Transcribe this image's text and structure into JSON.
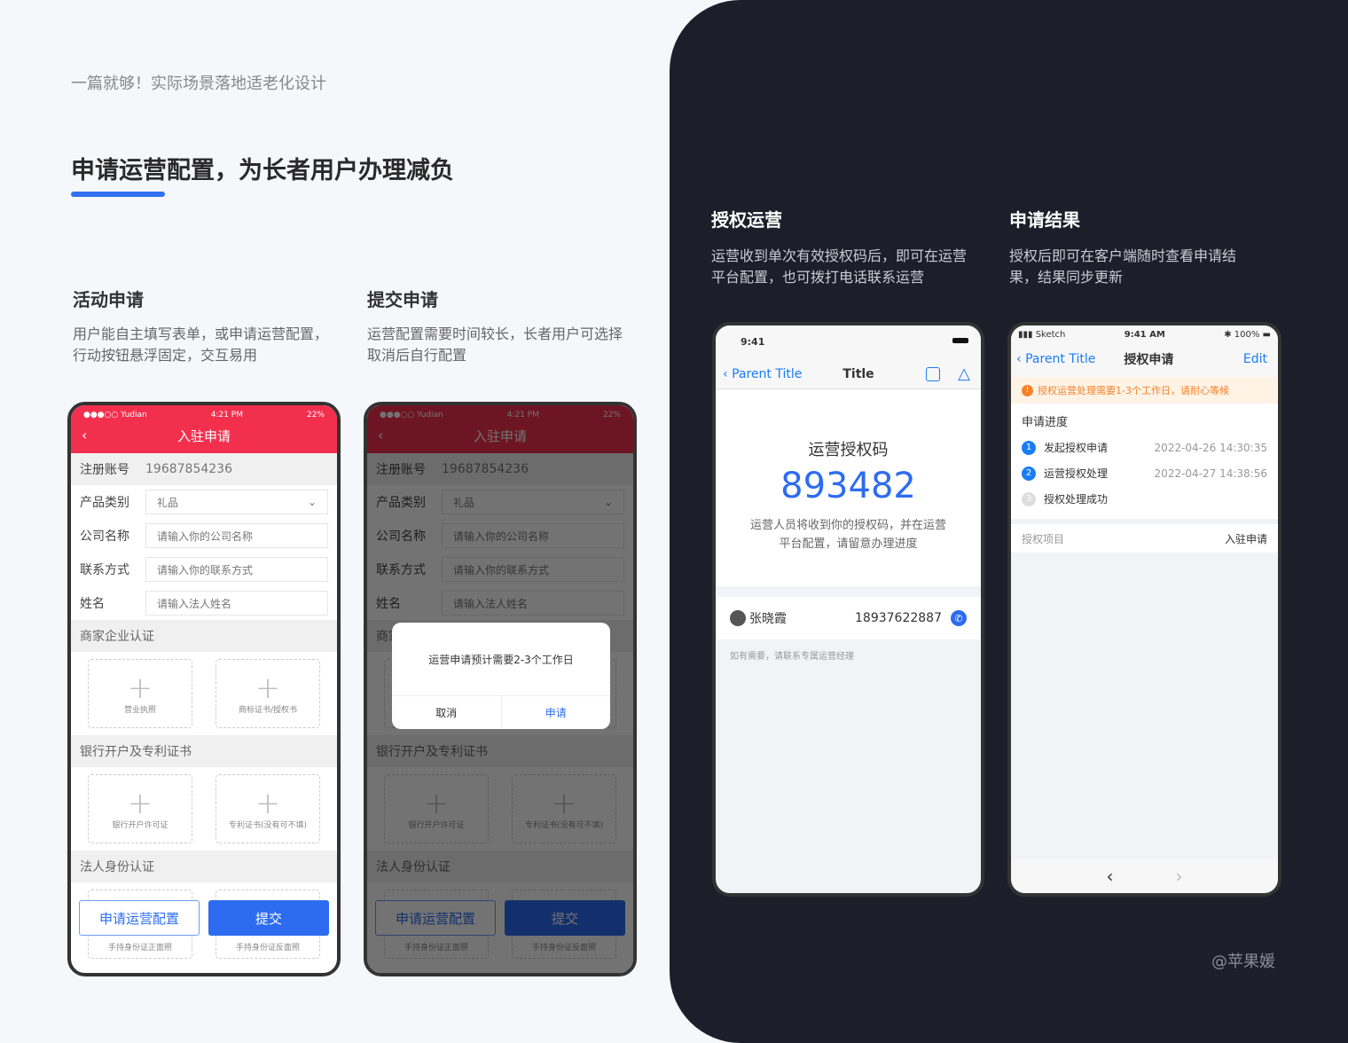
{
  "header": {
    "subtitle": "一篇就够！实际场景落地适老化设计",
    "title": "申请运营配置，为长者用户办理减负"
  },
  "sections": [
    {
      "title": "活动申请",
      "desc": "用户能自主填写表单，或申请运营配置，行动按钮悬浮固定，交互易用"
    },
    {
      "title": "提交申请",
      "desc": "运营配置需要时间较长，长者用户可选择取消后自行配置"
    },
    {
      "title": "授权运营",
      "desc": "运营收到单次有效授权码后，即可在运营平台配置，也可拨打电话联系运营"
    },
    {
      "title": "申请结果",
      "desc": "授权后即可在客户端随时查看申请结果，结果同步更新"
    }
  ],
  "form": {
    "status": {
      "carrier": "●●●○○ Yudian",
      "time": "4:21 PM",
      "battery": "22%"
    },
    "nav_title": "入驻申请",
    "back": "‹",
    "account_label": "注册账号",
    "account_value": "19687854236",
    "fields": [
      {
        "label": "产品类别",
        "value": "礼品"
      },
      {
        "label": "公司名称",
        "placeholder": "请输入你的公司名称"
      },
      {
        "label": "联系方式",
        "placeholder": "请输入你的联系方式"
      },
      {
        "label": "姓名",
        "placeholder": "请输入法人姓名"
      }
    ],
    "groups": [
      {
        "title": "商家企业认证",
        "uploads": [
          "营业执照",
          "商标证书/授权书"
        ]
      },
      {
        "title": "银行开户及专利证书",
        "uploads": [
          "银行开户许可证",
          "专利证书(没有可不填)"
        ]
      },
      {
        "title": "法人身份认证",
        "uploads": [
          "手持身份证正面照",
          "手持身份证反面照"
        ]
      }
    ],
    "apply_button": "申请运营配置",
    "submit_button": "提交"
  },
  "dialog": {
    "message": "运营申请预计需要2-3个工作日",
    "cancel": "取消",
    "confirm": "申请"
  },
  "code_screen": {
    "time": "9:41",
    "back": "Parent Title",
    "title": "Title",
    "heading": "运营授权码",
    "code": "893482",
    "desc1": "运营人员将收到你的授权码，并在运营",
    "desc2": "平台配置，请留意办理进度",
    "contact_name": "张晓霞",
    "contact_phone": "18937622887",
    "note": "如有需要，请联系专属运营经理"
  },
  "result_screen": {
    "carrier": "Sketch",
    "time": "9:41 AM",
    "battery": "100%",
    "back": "Parent Title",
    "title": "授权申请",
    "edit": "Edit",
    "notice": "授权运营处理需要1-3个工作日，请耐心等候",
    "progress_title": "申请进度",
    "steps": [
      {
        "n": "1",
        "label": "发起授权申请",
        "time": "2022-04-26  14:30:35"
      },
      {
        "n": "2",
        "label": "运营授权处理",
        "time": "2022-04-27  14:38:56"
      },
      {
        "n": "3",
        "label": "授权处理成功"
      }
    ],
    "item_label": "授权项目",
    "item_value": "入驻申请"
  },
  "watermark": "@苹果媛",
  "colors": {
    "accent": "#2d6cf0",
    "form_header": "#f2304e",
    "dark_bg": "#1c1f2a",
    "ios_blue": "#1a7cf5",
    "warning": "#f5822a"
  }
}
